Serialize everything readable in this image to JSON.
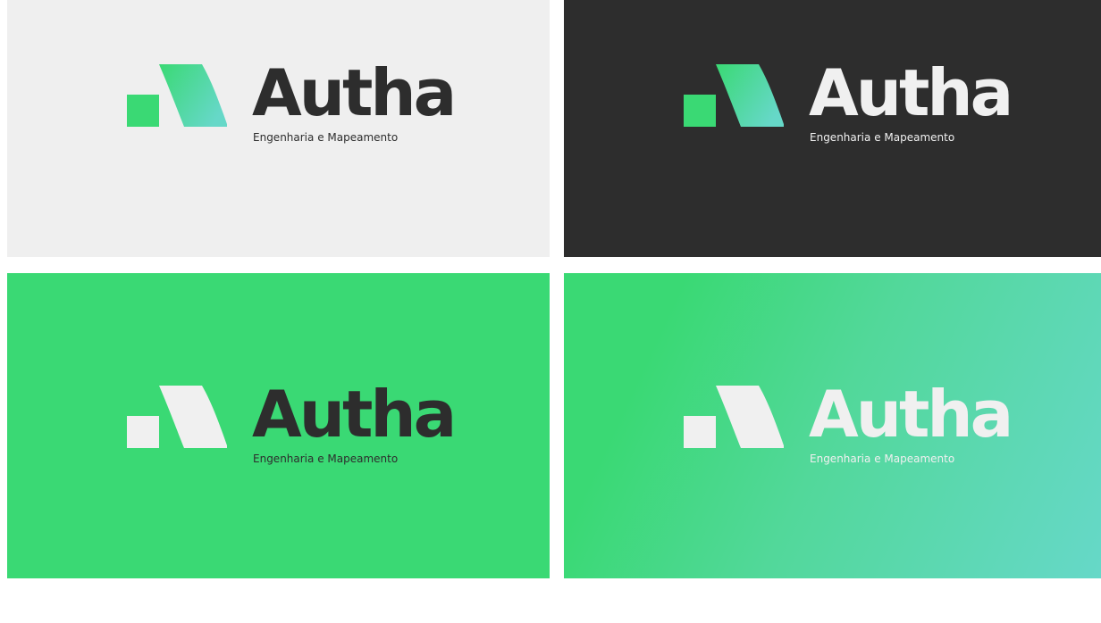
{
  "brand": {
    "name": "Autha",
    "tagline": "Engenharia e Mapeamento"
  },
  "colors": {
    "light_bg": "#efefef",
    "dark_bg": "#2d2d2d",
    "green": "#3ad974",
    "teal": "#66d8c8",
    "off_white": "#f0f0f0"
  },
  "panels": [
    {
      "background": "light",
      "mark": "green-teal-gradient",
      "wordmark_color": "#2d2d2d",
      "tagline_color": "#2d2d2d"
    },
    {
      "background": "dark",
      "mark": "green-teal-gradient",
      "wordmark_color": "#f0f0f0",
      "tagline_color": "#f0f0f0"
    },
    {
      "background": "green",
      "mark": "off-white",
      "wordmark_color": "#2d2d2d",
      "tagline_color": "#2d2d2d"
    },
    {
      "background": "green-teal-gradient",
      "mark": "off-white",
      "wordmark_color": "#f0f0f0",
      "tagline_color": "#f0f0f0"
    }
  ]
}
